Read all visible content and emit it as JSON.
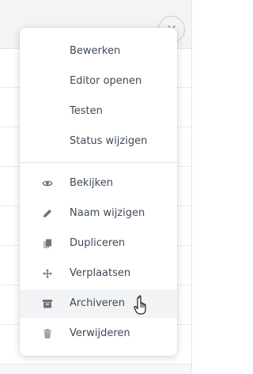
{
  "menu": {
    "items": [
      {
        "label": "Bewerken",
        "icon": "none"
      },
      {
        "label": "Editor openen",
        "icon": "none"
      },
      {
        "label": "Testen",
        "icon": "none"
      },
      {
        "label": "Status wijzigen",
        "icon": "none"
      },
      {
        "label": "Bekijken",
        "icon": "eye-icon"
      },
      {
        "label": "Naam wijzigen",
        "icon": "pencil-icon"
      },
      {
        "label": "Dupliceren",
        "icon": "copy-icon"
      },
      {
        "label": "Verplaatsen",
        "icon": "move-arrows-icon"
      },
      {
        "label": "Archiveren",
        "icon": "archive-box-icon",
        "hovered": true
      },
      {
        "label": "Verwijderen",
        "icon": "trash-icon"
      }
    ]
  },
  "colors": {
    "text": "#3d4a57",
    "icon": "#6b747d",
    "hover_bg": "#f2f3f5",
    "header_bg": "#f3f4f5"
  }
}
